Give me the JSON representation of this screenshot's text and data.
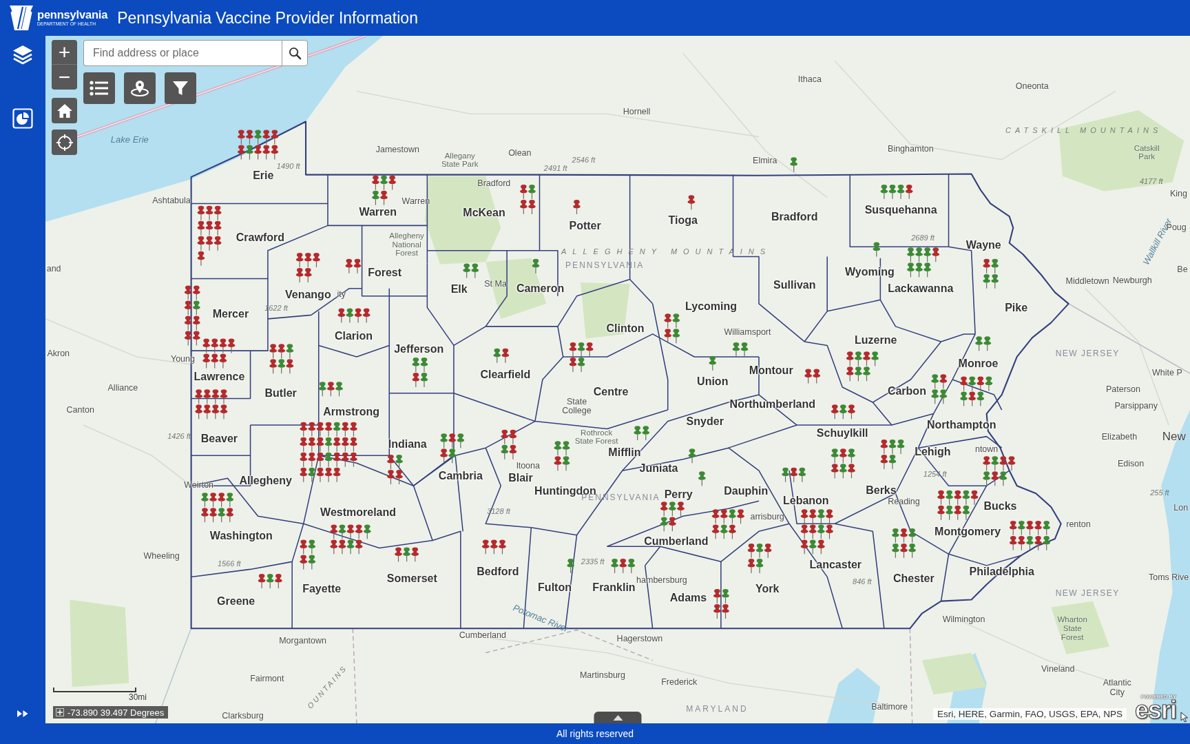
{
  "header": {
    "logo_name": "pennsylvania",
    "logo_subtitle": "DEPARTMENT OF HEALTH",
    "title": "Pennsylvania Vaccine Provider Information"
  },
  "map_tools": {
    "zoom_in": "+",
    "zoom_out": "−",
    "search": {
      "placeholder": "Find address or place"
    }
  },
  "map": {
    "counties": [
      {
        "name": "Erie",
        "pins": [
          {
            "color": "#b52a2d"
          },
          {
            "color": "#b52a2d"
          },
          {
            "color": "#3d8a36"
          },
          {
            "color": "#b52a2d"
          },
          {
            "color": "#b52a2d"
          },
          {
            "color": "#b52a2d"
          },
          {
            "color": "#3d8a36"
          },
          {
            "color": "#b52a2d"
          },
          {
            "color": "#b52a2d"
          },
          {
            "color": "#b52a2d"
          }
        ]
      },
      {
        "name": "Warren",
        "pins": [
          {
            "color": "#b52a2d"
          },
          {
            "color": "#3d8a36"
          },
          {
            "color": "#b52a2d"
          },
          {
            "color": "#3d8a36"
          },
          {
            "color": "#b52a2d"
          }
        ]
      },
      {
        "name": "McKean",
        "pins": [
          {
            "color": "#b52a2d"
          },
          {
            "color": "#3d8a36"
          },
          {
            "color": "#b52a2d"
          },
          {
            "color": "#b52a2d"
          }
        ]
      },
      {
        "name": "Tioga",
        "pins": [
          {
            "color": "#b52a2d"
          }
        ]
      },
      {
        "name": "Bradford",
        "pins": [
          {
            "color": "#3d8a36"
          }
        ]
      },
      {
        "name": "Susquehanna",
        "pins": [
          {
            "color": "#3d8a36"
          },
          {
            "color": "#3d8a36"
          },
          {
            "color": "#3d8a36"
          },
          {
            "color": "#b52a2d"
          }
        ]
      },
      {
        "name": "Potter",
        "pins": [
          {
            "color": "#b52a2d"
          }
        ]
      },
      {
        "name": "Crawford",
        "pins": [
          {
            "color": "#b52a2d"
          },
          {
            "color": "#b52a2d"
          },
          {
            "color": "#b52a2d"
          },
          {
            "color": "#b52a2d"
          },
          {
            "color": "#b52a2d"
          },
          {
            "color": "#b52a2d"
          },
          {
            "color": "#b52a2d"
          },
          {
            "color": "#b52a2d"
          },
          {
            "color": "#b52a2d"
          },
          {
            "color": "#b52a2d"
          }
        ]
      },
      {
        "name": "Wayne",
        "pins": [
          {
            "color": "#b52a2d"
          },
          {
            "color": "#3d8a36"
          },
          {
            "color": "#3d8a36"
          },
          {
            "color": "#3d8a36"
          }
        ]
      },
      {
        "name": "Forest",
        "pins": [
          {
            "color": "#b52a2d"
          },
          {
            "color": "#b52a2d"
          }
        ]
      },
      {
        "name": "Wyoming",
        "pins": [
          {
            "color": "#3d8a36"
          }
        ]
      },
      {
        "name": "Venango",
        "pins": [
          {
            "color": "#b52a2d"
          },
          {
            "color": "#b52a2d"
          },
          {
            "color": "#b52a2d"
          },
          {
            "color": "#b52a2d"
          },
          {
            "color": "#b52a2d"
          }
        ]
      },
      {
        "name": "Elk",
        "pins": [
          {
            "color": "#3d8a36"
          },
          {
            "color": "#3d8a36"
          }
        ]
      },
      {
        "name": "Cameron",
        "pins": [
          {
            "color": "#3d8a36"
          }
        ]
      },
      {
        "name": "Sullivan"
      },
      {
        "name": "Lackawanna",
        "pins": [
          {
            "color": "#3d8a36"
          },
          {
            "color": "#3d8a36"
          },
          {
            "color": "#3d8a36"
          },
          {
            "color": "#b52a2d"
          },
          {
            "color": "#3d8a36"
          },
          {
            "color": "#3d8a36"
          },
          {
            "color": "#3d8a36"
          }
        ]
      },
      {
        "name": "Mercer",
        "pins": [
          {
            "color": "#b52a2d"
          },
          {
            "color": "#b52a2d"
          },
          {
            "color": "#b52a2d"
          },
          {
            "color": "#3d8a36"
          },
          {
            "color": "#b52a2d"
          },
          {
            "color": "#b52a2d"
          },
          {
            "color": "#b52a2d"
          },
          {
            "color": "#b52a2d"
          }
        ]
      },
      {
        "name": "Lycoming",
        "pins": [
          {
            "color": "#b52a2d"
          },
          {
            "color": "#3d8a36"
          },
          {
            "color": "#b52a2d"
          },
          {
            "color": "#3d8a36"
          }
        ]
      },
      {
        "name": "Pike"
      },
      {
        "name": "Clarion",
        "pins": [
          {
            "color": "#b52a2d"
          },
          {
            "color": "#3d8a36"
          },
          {
            "color": "#b52a2d"
          },
          {
            "color": "#b52a2d"
          }
        ]
      },
      {
        "name": "Clinton"
      },
      {
        "name": "Luzerne",
        "pins": [
          {
            "color": "#b52a2d"
          },
          {
            "color": "#3d8a36"
          },
          {
            "color": "#b52a2d"
          },
          {
            "color": "#3d8a36"
          },
          {
            "color": "#b52a2d"
          },
          {
            "color": "#3d8a36"
          },
          {
            "color": "#3d8a36"
          }
        ]
      },
      {
        "name": "Jefferson",
        "pins": [
          {
            "color": "#3d8a36"
          },
          {
            "color": "#3d8a36"
          },
          {
            "color": "#b52a2d"
          },
          {
            "color": "#3d8a36"
          }
        ]
      },
      {
        "name": "Monroe",
        "pins": [
          {
            "color": "#3d8a36"
          },
          {
            "color": "#3d8a36"
          }
        ]
      },
      {
        "name": "Lawrence",
        "pins": [
          {
            "color": "#b52a2d"
          },
          {
            "color": "#b52a2d"
          },
          {
            "color": "#b52a2d"
          },
          {
            "color": "#b52a2d"
          },
          {
            "color": "#b52a2d"
          },
          {
            "color": "#b52a2d"
          },
          {
            "color": "#b52a2d"
          }
        ]
      },
      {
        "name": "Clearfield",
        "pins": [
          {
            "color": "#3d8a36"
          },
          {
            "color": "#b52a2d"
          }
        ]
      },
      {
        "name": "Union",
        "pins": [
          {
            "color": "#3d8a36"
          }
        ]
      },
      {
        "name": "Montour",
        "pins": [
          {
            "color": "#3d8a36"
          },
          {
            "color": "#3d8a36"
          }
        ]
      },
      {
        "name": "Butler",
        "pins": [
          {
            "color": "#b52a2d"
          },
          {
            "color": "#b52a2d"
          },
          {
            "color": "#3d8a36"
          },
          {
            "color": "#b52a2d"
          },
          {
            "color": "#3d8a36"
          },
          {
            "color": "#b52a2d"
          }
        ]
      },
      {
        "name": "Centre",
        "pins": [
          {
            "color": "#b52a2d"
          },
          {
            "color": "#3d8a36"
          },
          {
            "color": "#b52a2d"
          },
          {
            "color": "#b52a2d"
          },
          {
            "color": "#3d8a36"
          }
        ]
      },
      {
        "name": "Carbon",
        "pins": [
          {
            "color": "#3d8a36"
          },
          {
            "color": "#b52a2d"
          },
          {
            "color": "#3d8a36"
          },
          {
            "color": "#3d8a36"
          }
        ]
      },
      {
        "name": "Armstrong",
        "pins": [
          {
            "color": "#3d8a36"
          },
          {
            "color": "#b52a2d"
          },
          {
            "color": "#3d8a36"
          }
        ]
      },
      {
        "name": "Northumberland",
        "pins": [
          {
            "color": "#b52a2d"
          },
          {
            "color": "#b52a2d"
          }
        ]
      },
      {
        "name": "Snyder"
      },
      {
        "name": "Northampton",
        "pins": [
          {
            "color": "#b52a2d"
          },
          {
            "color": "#3d8a36"
          },
          {
            "color": "#b52a2d"
          },
          {
            "color": "#3d8a36"
          },
          {
            "color": "#3d8a36"
          },
          {
            "color": "#b52a2d"
          },
          {
            "color": "#3d8a36"
          }
        ]
      },
      {
        "name": "Beaver",
        "pins": [
          {
            "color": "#b52a2d"
          },
          {
            "color": "#b52a2d"
          },
          {
            "color": "#b52a2d"
          },
          {
            "color": "#b52a2d"
          },
          {
            "color": "#b52a2d"
          },
          {
            "color": "#b52a2d"
          },
          {
            "color": "#b52a2d"
          },
          {
            "color": "#b52a2d"
          }
        ]
      },
      {
        "name": "Schuylkill",
        "pins": [
          {
            "color": "#b52a2d"
          },
          {
            "color": "#3d8a36"
          },
          {
            "color": "#b52a2d"
          }
        ]
      },
      {
        "name": "Indiana",
        "pins": [
          {
            "color": "#b52a2d"
          },
          {
            "color": "#3d8a36"
          },
          {
            "color": "#b52a2d"
          },
          {
            "color": "#b52a2d"
          }
        ]
      },
      {
        "name": "Mifflin",
        "pins": [
          {
            "color": "#3d8a36"
          },
          {
            "color": "#3d8a36"
          }
        ]
      },
      {
        "name": "Lehigh",
        "pins": [
          {
            "color": "#b52a2d"
          },
          {
            "color": "#3d8a36"
          },
          {
            "color": "#3d8a36"
          },
          {
            "color": "#b52a2d"
          },
          {
            "color": "#3d8a36"
          }
        ]
      },
      {
        "name": "Allegheny",
        "pins": [
          {
            "color": "#b52a2d"
          },
          {
            "color": "#b52a2d"
          },
          {
            "color": "#b52a2d"
          },
          {
            "color": "#b52a2d"
          },
          {
            "color": "#3d8a36"
          },
          {
            "color": "#b52a2d"
          },
          {
            "color": "#b52a2d"
          },
          {
            "color": "#b52a2d"
          },
          {
            "color": "#b52a2d"
          },
          {
            "color": "#b52a2d"
          },
          {
            "color": "#3d8a36"
          },
          {
            "color": "#b52a2d"
          },
          {
            "color": "#b52a2d"
          },
          {
            "color": "#b52a2d"
          },
          {
            "color": "#b52a2d"
          },
          {
            "color": "#b52a2d"
          },
          {
            "color": "#b52a2d"
          },
          {
            "color": "#3d8a36"
          },
          {
            "color": "#b52a2d"
          },
          {
            "color": "#b52a2d"
          },
          {
            "color": "#b52a2d"
          },
          {
            "color": "#b52a2d"
          },
          {
            "color": "#3d8a36"
          },
          {
            "color": "#b52a2d"
          },
          {
            "color": "#b52a2d"
          },
          {
            "color": "#b52a2d"
          }
        ]
      },
      {
        "name": "Cambria",
        "pins": [
          {
            "color": "#3d8a36"
          },
          {
            "color": "#b52a2d"
          },
          {
            "color": "#3d8a36"
          },
          {
            "color": "#b52a2d"
          },
          {
            "color": "#3d8a36"
          }
        ]
      },
      {
        "name": "Blair",
        "pins": [
          {
            "color": "#b52a2d"
          },
          {
            "color": "#b52a2d"
          },
          {
            "color": "#3d8a36"
          },
          {
            "color": "#b52a2d"
          }
        ]
      },
      {
        "name": "Juniata",
        "pins": [
          {
            "color": "#3d8a36"
          }
        ]
      },
      {
        "name": "Huntingdon",
        "pins": [
          {
            "color": "#3d8a36"
          },
          {
            "color": "#3d8a36"
          },
          {
            "color": "#b52a2d"
          },
          {
            "color": "#3d8a36"
          }
        ]
      },
      {
        "name": "Perry",
        "pins": [
          {
            "color": "#3d8a36"
          }
        ]
      },
      {
        "name": "Dauphin",
        "pins": [
          {
            "color": "#b52a2d"
          },
          {
            "color": "#b52a2d"
          },
          {
            "color": "#3d8a36"
          },
          {
            "color": "#b52a2d"
          },
          {
            "color": "#b52a2d"
          },
          {
            "color": "#3d8a36"
          },
          {
            "color": "#b52a2d"
          }
        ]
      },
      {
        "name": "Lebanon",
        "pins": [
          {
            "color": "#3d8a36"
          },
          {
            "color": "#b52a2d"
          },
          {
            "color": "#3d8a36"
          }
        ]
      },
      {
        "name": "Berks",
        "pins": [
          {
            "color": "#3d8a36"
          },
          {
            "color": "#b52a2d"
          },
          {
            "color": "#3d8a36"
          },
          {
            "color": "#b52a2d"
          },
          {
            "color": "#3d8a36"
          },
          {
            "color": "#b52a2d"
          }
        ]
      },
      {
        "name": "Westmoreland",
        "pins": [
          {
            "color": "#b52a2d"
          },
          {
            "color": "#3d8a36"
          },
          {
            "color": "#b52a2d"
          },
          {
            "color": "#b52a2d"
          },
          {
            "color": "#3d8a36"
          },
          {
            "color": "#b52a2d"
          },
          {
            "color": "#b52a2d"
          },
          {
            "color": "#3d8a36"
          },
          {
            "color": "#b52a2d"
          }
        ]
      },
      {
        "name": "Bucks",
        "pins": [
          {
            "color": "#b52a2d"
          },
          {
            "color": "#3d8a36"
          },
          {
            "color": "#b52a2d"
          },
          {
            "color": "#b52a2d"
          },
          {
            "color": "#3d8a36"
          },
          {
            "color": "#b52a2d"
          },
          {
            "color": "#3d8a36"
          }
        ]
      },
      {
        "name": "Washington",
        "pins": [
          {
            "color": "#3d8a36"
          },
          {
            "color": "#b52a2d"
          },
          {
            "color": "#b52a2d"
          },
          {
            "color": "#3d8a36"
          },
          {
            "color": "#b52a2d"
          },
          {
            "color": "#b52a2d"
          },
          {
            "color": "#3d8a36"
          },
          {
            "color": "#b52a2d"
          }
        ]
      },
      {
        "name": "Cumberland",
        "pins": [
          {
            "color": "#b52a2d"
          },
          {
            "color": "#3d8a36"
          },
          {
            "color": "#b52a2d"
          },
          {
            "color": "#3d8a36"
          },
          {
            "color": "#b52a2d"
          }
        ]
      },
      {
        "name": "Montgomery",
        "pins": [
          {
            "color": "#b52a2d"
          },
          {
            "color": "#3d8a36"
          },
          {
            "color": "#b52a2d"
          },
          {
            "color": "#3d8a36"
          },
          {
            "color": "#b52a2d"
          },
          {
            "color": "#b52a2d"
          },
          {
            "color": "#3d8a36"
          },
          {
            "color": "#b52a2d"
          },
          {
            "color": "#3d8a36"
          }
        ]
      },
      {
        "name": "Lancaster",
        "pins": [
          {
            "color": "#b52a2d"
          },
          {
            "color": "#b52a2d"
          },
          {
            "color": "#3d8a36"
          },
          {
            "color": "#b52a2d"
          },
          {
            "color": "#b52a2d"
          },
          {
            "color": "#b52a2d"
          },
          {
            "color": "#3d8a36"
          },
          {
            "color": "#b52a2d"
          },
          {
            "color": "#b52a2d"
          },
          {
            "color": "#3d8a36"
          },
          {
            "color": "#b52a2d"
          }
        ]
      },
      {
        "name": "Somerset",
        "pins": [
          {
            "color": "#b52a2d"
          },
          {
            "color": "#3d8a36"
          },
          {
            "color": "#b52a2d"
          }
        ]
      },
      {
        "name": "Bedford",
        "pins": [
          {
            "color": "#b52a2d"
          },
          {
            "color": "#b52a2d"
          },
          {
            "color": "#b52a2d"
          }
        ]
      },
      {
        "name": "Chester",
        "pins": [
          {
            "color": "#3d8a36"
          },
          {
            "color": "#b52a2d"
          },
          {
            "color": "#3d8a36"
          },
          {
            "color": "#3d8a36"
          },
          {
            "color": "#b52a2d"
          },
          {
            "color": "#3d8a36"
          }
        ]
      },
      {
        "name": "Philadelphia",
        "pins": [
          {
            "color": "#b52a2d"
          },
          {
            "color": "#3d8a36"
          },
          {
            "color": "#b52a2d"
          },
          {
            "color": "#b52a2d"
          },
          {
            "color": "#3d8a36"
          },
          {
            "color": "#b52a2d"
          },
          {
            "color": "#b52a2d"
          },
          {
            "color": "#3d8a36"
          },
          {
            "color": "#b52a2d"
          },
          {
            "color": "#3d8a36"
          }
        ]
      },
      {
        "name": "Fayette",
        "pins": [
          {
            "color": "#b52a2d"
          },
          {
            "color": "#3d8a36"
          },
          {
            "color": "#b52a2d"
          },
          {
            "color": "#3d8a36"
          }
        ]
      },
      {
        "name": "Fulton",
        "pins": [
          {
            "color": "#3d8a36"
          }
        ]
      },
      {
        "name": "Franklin",
        "pins": [
          {
            "color": "#3d8a36"
          },
          {
            "color": "#b52a2d"
          },
          {
            "color": "#3d8a36"
          }
        ]
      },
      {
        "name": "York",
        "pins": [
          {
            "color": "#b52a2d"
          },
          {
            "color": "#3d8a36"
          },
          {
            "color": "#b52a2d"
          },
          {
            "color": "#b52a2d"
          },
          {
            "color": "#3d8a36"
          }
        ]
      },
      {
        "name": "Greene",
        "pins": [
          {
            "color": "#b52a2d"
          },
          {
            "color": "#3d8a36"
          },
          {
            "color": "#b52a2d"
          }
        ]
      },
      {
        "name": "Adams",
        "pins": [
          {
            "color": "#b52a2d"
          },
          {
            "color": "#3d8a36"
          },
          {
            "color": "#b52a2d"
          },
          {
            "color": "#b52a2d"
          }
        ]
      }
    ],
    "places": [
      {
        "kind": "city",
        "text": "Ithaca"
      },
      {
        "kind": "city",
        "text": "Oneonta"
      },
      {
        "kind": "city",
        "text": "Hornell"
      },
      {
        "kind": "region",
        "text": "CATSKILL MOUNTAINS"
      },
      {
        "kind": "water",
        "text": "Lake Erie"
      },
      {
        "kind": "city",
        "text": "Jamestown"
      },
      {
        "kind": "city",
        "text": "Olean"
      },
      {
        "kind": "city",
        "text": "Binghamton"
      },
      {
        "kind": "park",
        "text": "Allegany State Park"
      },
      {
        "kind": "elevation",
        "text": "2546 ft"
      },
      {
        "kind": "city",
        "text": "Elmira"
      },
      {
        "kind": "park",
        "text": "Catskill Park"
      },
      {
        "kind": "elevation",
        "text": "1490 ft"
      },
      {
        "kind": "elevation",
        "text": "2491 ft"
      },
      {
        "kind": "city",
        "text": "Bradford"
      },
      {
        "kind": "elevation",
        "text": "4177 ft"
      },
      {
        "kind": "city",
        "text": "King"
      },
      {
        "kind": "city",
        "text": "Ashtabula"
      },
      {
        "kind": "city",
        "text": "Warren"
      },
      {
        "kind": "park",
        "text": "Allegheny National Forest"
      },
      {
        "kind": "elevation",
        "text": "2689 ft"
      },
      {
        "kind": "region",
        "text": "ALLEGHENY MOUNTAINS"
      },
      {
        "kind": "water",
        "text": "Wallkill River"
      },
      {
        "kind": "city",
        "text": "Poug"
      },
      {
        "kind": "city",
        "text": "and"
      },
      {
        "kind": "state",
        "text": "PENNSYLVANIA"
      },
      {
        "kind": "city",
        "text": "Be"
      },
      {
        "kind": "city",
        "text": "St Ma"
      },
      {
        "kind": "city",
        "text": "Middletown"
      },
      {
        "kind": "city",
        "text": "Newburgh"
      },
      {
        "kind": "city",
        "text": "ity"
      },
      {
        "kind": "elevation",
        "text": "1622 ft"
      },
      {
        "kind": "city",
        "text": "Williamsport"
      },
      {
        "kind": "city",
        "text": "Akron"
      },
      {
        "kind": "city",
        "text": "Young"
      },
      {
        "kind": "state",
        "text": "NEW JERSEY"
      },
      {
        "kind": "city",
        "text": "White P"
      },
      {
        "kind": "city",
        "text": "Alliance"
      },
      {
        "kind": "city",
        "text": "Paterson"
      },
      {
        "kind": "city",
        "text": "Canton"
      },
      {
        "kind": "city",
        "text": "State College"
      },
      {
        "kind": "city",
        "text": "Parsippany"
      },
      {
        "kind": "elevation",
        "text": "1426 ft"
      },
      {
        "kind": "park",
        "text": "Rothrock State Forest"
      },
      {
        "kind": "city",
        "text": "Elizabeth"
      },
      {
        "kind": "metro",
        "text": "New"
      },
      {
        "kind": "city",
        "text": "ntown"
      },
      {
        "kind": "city",
        "text": "ltoona"
      },
      {
        "kind": "city",
        "text": "Edison"
      },
      {
        "kind": "elevation",
        "text": "1254 ft"
      },
      {
        "kind": "city",
        "text": "Weirton"
      },
      {
        "kind": "state",
        "text": "PENNSYLVANIA"
      },
      {
        "kind": "elevation",
        "text": "255 ft"
      },
      {
        "kind": "city",
        "text": "Reading"
      },
      {
        "kind": "elevation",
        "text": "3128 ft"
      },
      {
        "kind": "city",
        "text": "Lon"
      },
      {
        "kind": "city",
        "text": "arrisburg"
      },
      {
        "kind": "city",
        "text": "renton"
      },
      {
        "kind": "city",
        "text": "Wheeling"
      },
      {
        "kind": "elevation",
        "text": "1566 ft"
      },
      {
        "kind": "elevation",
        "text": "2335 ft"
      },
      {
        "kind": "city",
        "text": "hambersburg"
      },
      {
        "kind": "elevation",
        "text": "846 ft"
      },
      {
        "kind": "city",
        "text": "Toms Rive"
      },
      {
        "kind": "state",
        "text": "NEW JERSEY"
      },
      {
        "kind": "water",
        "text": "Potomac River"
      },
      {
        "kind": "city",
        "text": "Wilmington"
      },
      {
        "kind": "city",
        "text": "Morgantown"
      },
      {
        "kind": "city",
        "text": "Cumberland"
      },
      {
        "kind": "city",
        "text": "Hagerstown"
      },
      {
        "kind": "park",
        "text": "Wharton State Forest"
      },
      {
        "kind": "city",
        "text": "Vineland"
      },
      {
        "kind": "city",
        "text": "Fairmont"
      },
      {
        "kind": "region",
        "text": "OUNTAINS"
      },
      {
        "kind": "city",
        "text": "Martinsburg"
      },
      {
        "kind": "city",
        "text": "Frederick"
      },
      {
        "kind": "city",
        "text": "Atlantic City"
      },
      {
        "kind": "city",
        "text": "Clarksburg"
      },
      {
        "kind": "state",
        "text": "MARYLAND"
      },
      {
        "kind": "city",
        "text": "Baltimore"
      }
    ],
    "scale_label": "30mi",
    "coordinates": "-73.890 39.497 Degrees",
    "attribution": "Esri, HERE, Garmin, FAO, USGS, EPA, NPS",
    "esri_logo": {
      "tagline": "POWERED BY",
      "wordmark": "esri"
    }
  },
  "footer": {
    "text": "All rights reserved"
  }
}
